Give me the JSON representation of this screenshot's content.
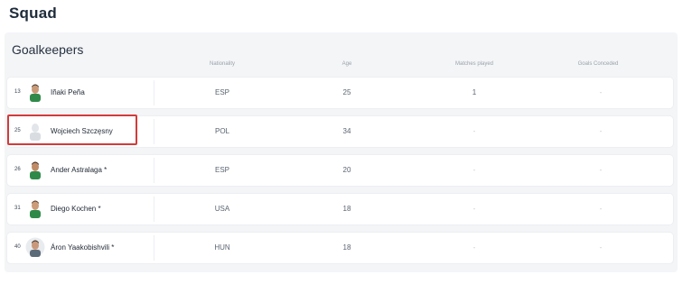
{
  "page": {
    "title": "Squad"
  },
  "section": {
    "title": "Goalkeepers"
  },
  "columns": {
    "nationality": "Nationality",
    "age": "Age",
    "matches": "Matches played",
    "goals": "Goals Conceded"
  },
  "players": [
    {
      "number": "13",
      "name": "Iñaki Peña",
      "nationality": "ESP",
      "age": "25",
      "matches": "1",
      "goals": "-"
    },
    {
      "number": "25",
      "name": "Wojciech Szczęsny",
      "nationality": "POL",
      "age": "34",
      "matches": "-",
      "goals": "-"
    },
    {
      "number": "26",
      "name": "Ander Astralaga *",
      "nationality": "ESP",
      "age": "20",
      "matches": "-",
      "goals": "-"
    },
    {
      "number": "31",
      "name": "Diego Kochen *",
      "nationality": "USA",
      "age": "18",
      "matches": "-",
      "goals": "-"
    },
    {
      "number": "40",
      "name": "Áron Yaakobishvili *",
      "nationality": "HUN",
      "age": "18",
      "matches": "-",
      "goals": "-"
    }
  ],
  "colors": {
    "highlight": "#d33b3b",
    "kit_green": "#2f8a4a"
  },
  "icons": {
    "avatar": "player-avatar-icon",
    "placeholder": "silhouette-icon"
  }
}
